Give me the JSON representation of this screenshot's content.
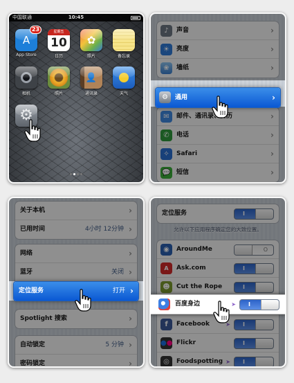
{
  "home": {
    "status": {
      "carrier": "中国联通",
      "time": "10:45"
    },
    "apps": [
      {
        "label": "App Store",
        "icon": "app-store-icon",
        "badge": "23",
        "color": "#1d7fd9"
      },
      {
        "label": "日历",
        "icon": "calendar-icon",
        "day": "10",
        "weekday": "星期五",
        "color": "#ffffff"
      },
      {
        "label": "照片",
        "icon": "photos-icon",
        "color": "#9a9a9a"
      },
      {
        "label": "备忘录",
        "icon": "notes-icon",
        "color": "#f3da6f"
      },
      {
        "label": "相机",
        "icon": "camera-icon",
        "color": "#3e4247"
      },
      {
        "label": "照片",
        "icon": "sunflower-icon",
        "color": "#a48a3f"
      },
      {
        "label": "通讯录",
        "icon": "contacts-icon",
        "color": "#7a5a3d"
      },
      {
        "label": "天气",
        "icon": "weather-icon",
        "color": "#3c8fe0"
      },
      {
        "label": "设置",
        "icon": "settings-icon",
        "color": "#8a8f96"
      }
    ]
  },
  "settings": {
    "rows": [
      {
        "label": "声音",
        "icon": "sound-icon",
        "color": "#6d7784"
      },
      {
        "label": "亮度",
        "icon": "brightness-icon",
        "color": "#2f7bd8"
      },
      {
        "label": "墙纸",
        "icon": "wallpaper-icon",
        "color": "#5aa2e0"
      },
      {
        "label": "通用",
        "icon": "general-icon",
        "color": "#7d848d",
        "selected": true
      },
      {
        "label": "邮件、通讯录、日历",
        "icon": "mail-icon",
        "color": "#3e88e0"
      },
      {
        "label": "电话",
        "icon": "phone-icon",
        "color": "#2f9a3d"
      },
      {
        "label": "Safari",
        "icon": "safari-icon",
        "color": "#2a6fd1"
      },
      {
        "label": "短信",
        "icon": "messages-icon",
        "color": "#3cae3a"
      }
    ]
  },
  "general": {
    "group1": [
      {
        "label": "关于本机"
      },
      {
        "label": "已用时间",
        "value": "4小时 12分钟"
      }
    ],
    "group2": [
      {
        "label": "网络"
      },
      {
        "label": "蓝牙",
        "value": "关闭"
      },
      {
        "label": "定位服务",
        "value": "打开",
        "selected": true
      }
    ],
    "group3": [
      {
        "label": "Spotlight 搜索"
      }
    ],
    "group4": [
      {
        "label": "自动锁定",
        "value": "5 分钟"
      },
      {
        "label": "密码锁定"
      }
    ]
  },
  "location": {
    "master_label": "定位服务",
    "switch_on": "I",
    "switch_off": "O",
    "note": "允许以下应用程序确定您的大致位置。",
    "apps": [
      {
        "label": "AroundMe",
        "icon": "aroundme-icon",
        "color": "#2a5fb0",
        "on": false,
        "arrow": false
      },
      {
        "label": "Ask.com",
        "icon": "ask-icon",
        "color": "#d22a2a",
        "on": true,
        "arrow": false
      },
      {
        "label": "Cut the Rope",
        "icon": "cut-the-rope-icon",
        "color": "#7a9a2e",
        "on": true,
        "arrow": false
      },
      {
        "label": "百度身边",
        "icon": "baidu-nearby-icon",
        "color": "#3d7fe3",
        "on": true,
        "arrow": true,
        "highlight": true
      },
      {
        "label": "Facebook",
        "icon": "facebook-icon",
        "color": "#3b5998",
        "on": true,
        "arrow": true
      },
      {
        "label": "Flickr",
        "icon": "flickr-icon",
        "color": "#333333",
        "on": true,
        "arrow": false
      },
      {
        "label": "Foodspotting",
        "icon": "foodspotting-icon",
        "color": "#333333",
        "on": true,
        "arrow": true
      }
    ],
    "arrow_glyph": "➤"
  }
}
